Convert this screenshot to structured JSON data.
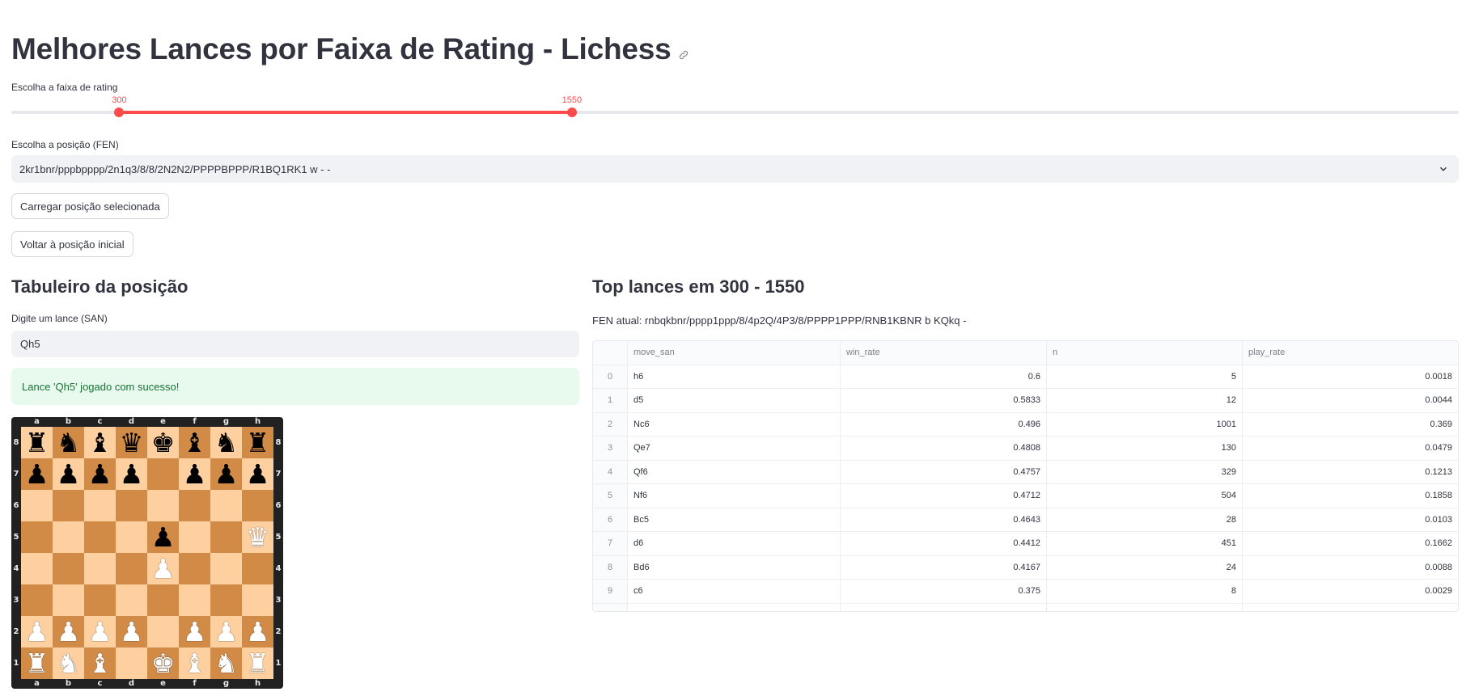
{
  "page_title": "Melhores Lances por Faixa de Rating - Lichess",
  "slider": {
    "label": "Escolha a faixa de rating",
    "low_label": "300",
    "high_label": "1550",
    "low_fraction": 0.0746,
    "high_fraction": 0.3873,
    "accent_color": "#ff4b4b"
  },
  "fen_select": {
    "label": "Escolha a posição (FEN)",
    "value": "2kr1bnr/pppbpppp/2n1q3/8/8/2N2N2/PPPPBPPP/R1BQ1RK1 w - -"
  },
  "buttons": {
    "load": "Carregar posição selecionada",
    "reset": "Voltar à posição inicial"
  },
  "left": {
    "heading": "Tabuleiro da posição",
    "move_input_label": "Digite um lance (SAN)",
    "move_input_value": "Qh5",
    "success_message": "Lance 'Qh5' jogado com sucesso!"
  },
  "board": {
    "files": [
      "a",
      "b",
      "c",
      "d",
      "e",
      "f",
      "g",
      "h"
    ],
    "ranks": [
      "8",
      "7",
      "6",
      "5",
      "4",
      "3",
      "2",
      "1"
    ],
    "position": [
      [
        "r",
        "n",
        "b",
        "q",
        "k",
        "b",
        "n",
        "r"
      ],
      [
        "p",
        "p",
        "p",
        "p",
        "",
        "p",
        "p",
        "p"
      ],
      [
        "",
        "",
        "",
        "",
        "",
        "",
        "",
        ""
      ],
      [
        "",
        "",
        "",
        "",
        "p",
        "",
        "",
        "Q"
      ],
      [
        "",
        "",
        "",
        "",
        "P",
        "",
        "",
        ""
      ],
      [
        "",
        "",
        "",
        "",
        "",
        "",
        "",
        ""
      ],
      [
        "P",
        "P",
        "P",
        "P",
        "",
        "P",
        "P",
        "P"
      ],
      [
        "R",
        "N",
        "B",
        "",
        "K",
        "B",
        "N",
        "R"
      ]
    ],
    "light_color": "#fecf9f",
    "dark_color": "#d18b47"
  },
  "right": {
    "heading": "Top lances em 300 - 1550",
    "fen_current": "FEN atual: rnbqkbnr/pppp1ppp/8/4p2Q/4P3/8/PPPP1PPP/RNB1KBNR b KQkq -"
  },
  "table": {
    "columns": [
      "",
      "move_san",
      "win_rate",
      "n",
      "play_rate"
    ],
    "rows": [
      [
        "0",
        "h6",
        "0.6",
        "5",
        "0.0018"
      ],
      [
        "1",
        "d5",
        "0.5833",
        "12",
        "0.0044"
      ],
      [
        "2",
        "Nc6",
        "0.496",
        "1001",
        "0.369"
      ],
      [
        "3",
        "Qe7",
        "0.4808",
        "130",
        "0.0479"
      ],
      [
        "4",
        "Qf6",
        "0.4757",
        "329",
        "0.1213"
      ],
      [
        "5",
        "Nf6",
        "0.4712",
        "504",
        "0.1858"
      ],
      [
        "6",
        "Bc5",
        "0.4643",
        "28",
        "0.0103"
      ],
      [
        "7",
        "d6",
        "0.4412",
        "451",
        "0.1662"
      ],
      [
        "8",
        "Bd6",
        "0.4167",
        "24",
        "0.0088"
      ],
      [
        "9",
        "c6",
        "0.375",
        "8",
        "0.0029"
      ]
    ]
  }
}
